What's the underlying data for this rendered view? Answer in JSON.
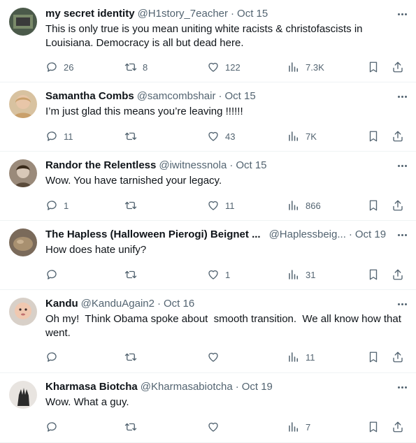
{
  "tweets": [
    {
      "name": "my secret identity",
      "handle": "@H1story_7eacher",
      "date": "Oct 15",
      "text": "This is only true is you mean uniting white racists & christofascists in Louisiana. Democracy is all but dead here.",
      "replies": "26",
      "retweets": "8",
      "likes": "122",
      "views": "7.3K",
      "avatar_color": "#3a4a3a"
    },
    {
      "name": "Samantha Combs",
      "handle": "@samcombshair",
      "date": "Oct 15",
      "text": "I’m just glad this means you’re leaving !!!!!!",
      "replies": "11",
      "retweets": "",
      "likes": "43",
      "views": "7K",
      "avatar_color": "#c9a06b"
    },
    {
      "name": "Randor the Relentless",
      "handle": "@iwitnessnola",
      "date": "Oct 15",
      "text": "Wow. You have tarnished your legacy.",
      "replies": "1",
      "retweets": "",
      "likes": "11",
      "views": "866",
      "avatar_color": "#8a7a6a"
    },
    {
      "name": "The Hapless (Halloween Pierogi) Beignet ...",
      "handle": "@Haplessbeig...",
      "date": "Oct 19",
      "text": "How does hate unify?",
      "replies": "",
      "retweets": "",
      "likes": "1",
      "views": "31",
      "avatar_color": "#6b5a4a"
    },
    {
      "name": "Kandu",
      "handle": "@KanduAgain2",
      "date": "Oct 16",
      "text": "Oh my!  Think Obama spoke about  smooth transition.  We all know how that went.",
      "replies": "",
      "retweets": "",
      "likes": "",
      "views": "11",
      "avatar_color": "#e8c0a8"
    },
    {
      "name": "Kharmasa Biotcha",
      "handle": "@Kharmasabiotcha",
      "date": "Oct 19",
      "text": "Wow. What a guy.",
      "replies": "",
      "retweets": "",
      "likes": "",
      "views": "7",
      "avatar_color": "#2b2b2b"
    }
  ],
  "icons": {
    "reply": "reply-icon",
    "retweet": "retweet-icon",
    "like": "heart-icon",
    "views": "views-icon",
    "bookmark": "bookmark-icon",
    "share": "share-icon",
    "more": "more-icon"
  }
}
